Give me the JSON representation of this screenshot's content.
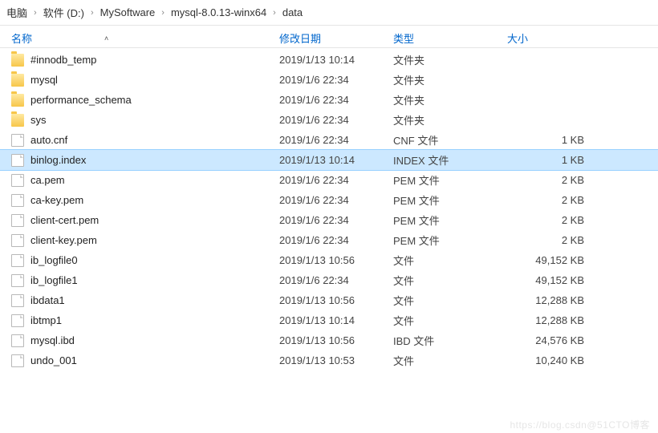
{
  "breadcrumb": {
    "items": [
      "电脑",
      "软件 (D:)",
      "MySoftware",
      "mysql-8.0.13-winx64",
      "data"
    ],
    "separator": "›"
  },
  "columns": {
    "name": "名称",
    "date": "修改日期",
    "type": "类型",
    "size": "大小"
  },
  "rows": [
    {
      "icon": "folder",
      "name": "#innodb_temp",
      "date": "2019/1/13 10:14",
      "type": "文件夹",
      "size": ""
    },
    {
      "icon": "folder",
      "name": "mysql",
      "date": "2019/1/6 22:34",
      "type": "文件夹",
      "size": ""
    },
    {
      "icon": "folder",
      "name": "performance_schema",
      "date": "2019/1/6 22:34",
      "type": "文件夹",
      "size": ""
    },
    {
      "icon": "folder",
      "name": "sys",
      "date": "2019/1/6 22:34",
      "type": "文件夹",
      "size": ""
    },
    {
      "icon": "file",
      "name": "auto.cnf",
      "date": "2019/1/6 22:34",
      "type": "CNF 文件",
      "size": "1 KB"
    },
    {
      "icon": "file",
      "name": "binlog.index",
      "date": "2019/1/13 10:14",
      "type": "INDEX 文件",
      "size": "1 KB",
      "selected": true
    },
    {
      "icon": "file",
      "name": "ca.pem",
      "date": "2019/1/6 22:34",
      "type": "PEM 文件",
      "size": "2 KB"
    },
    {
      "icon": "file",
      "name": "ca-key.pem",
      "date": "2019/1/6 22:34",
      "type": "PEM 文件",
      "size": "2 KB"
    },
    {
      "icon": "file",
      "name": "client-cert.pem",
      "date": "2019/1/6 22:34",
      "type": "PEM 文件",
      "size": "2 KB"
    },
    {
      "icon": "file",
      "name": "client-key.pem",
      "date": "2019/1/6 22:34",
      "type": "PEM 文件",
      "size": "2 KB"
    },
    {
      "icon": "file",
      "name": "ib_logfile0",
      "date": "2019/1/13 10:56",
      "type": "文件",
      "size": "49,152 KB"
    },
    {
      "icon": "file",
      "name": "ib_logfile1",
      "date": "2019/1/6 22:34",
      "type": "文件",
      "size": "49,152 KB"
    },
    {
      "icon": "file",
      "name": "ibdata1",
      "date": "2019/1/13 10:56",
      "type": "文件",
      "size": "12,288 KB"
    },
    {
      "icon": "file",
      "name": "ibtmp1",
      "date": "2019/1/13 10:14",
      "type": "文件",
      "size": "12,288 KB"
    },
    {
      "icon": "file",
      "name": "mysql.ibd",
      "date": "2019/1/13 10:56",
      "type": "IBD 文件",
      "size": "24,576 KB"
    },
    {
      "icon": "file",
      "name": "undo_001",
      "date": "2019/1/13 10:53",
      "type": "文件",
      "size": "10,240 KB"
    }
  ],
  "watermark": "https://blog.csdn@51CTO博客"
}
